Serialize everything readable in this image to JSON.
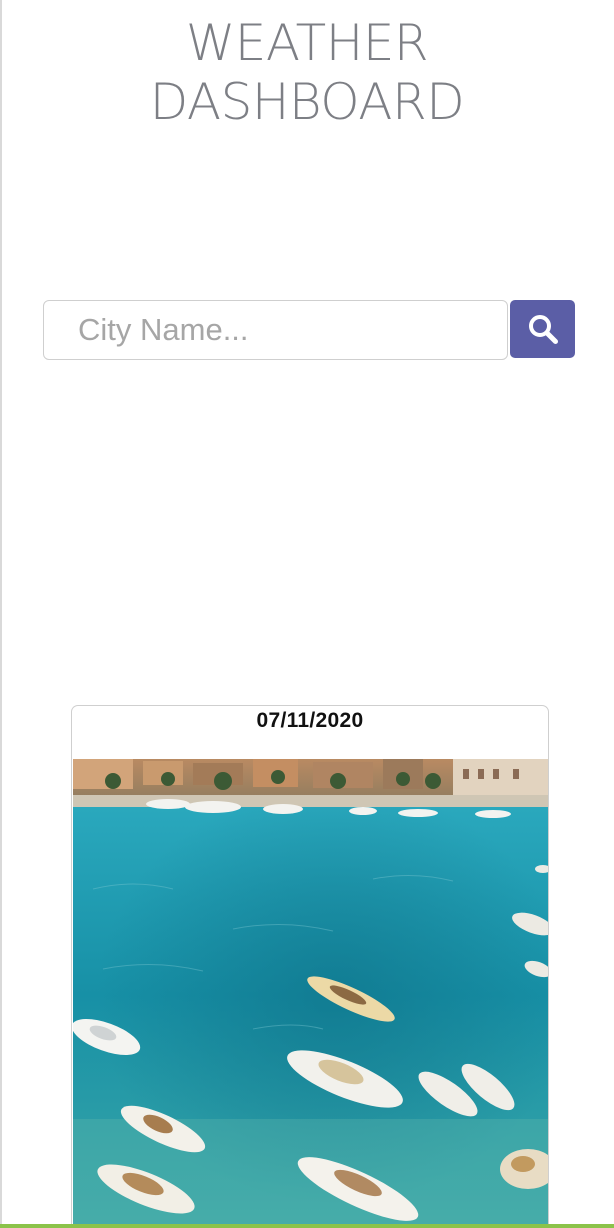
{
  "header": {
    "title_line1": "WEATHER",
    "title_line2": "DASHBOARD"
  },
  "search": {
    "placeholder": "City Name...",
    "value": "",
    "button_icon": "search-icon",
    "button_color": "#5b5ea6"
  },
  "forecast_card": {
    "date": "07/11/2020",
    "image": "harbor-boats-turquoise-water"
  },
  "colors": {
    "title": "#7d7f85",
    "accent": "#5b5ea6",
    "water": "#1e9fb3"
  }
}
